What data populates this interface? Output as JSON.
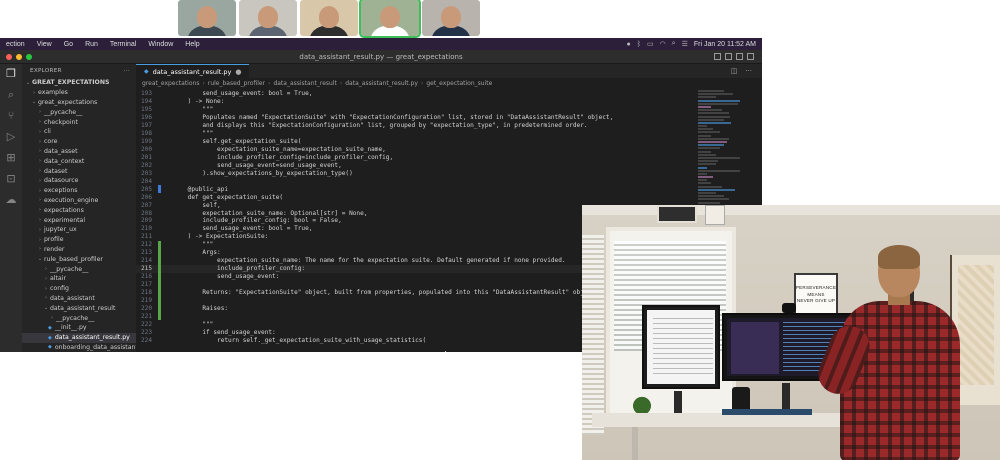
{
  "call": {
    "tiles": [
      {
        "bg": "#9aa7a1",
        "shirt": "#3d4a52"
      },
      {
        "bg": "#c9c6c0",
        "shirt": "#5b6470"
      },
      {
        "bg": "#d8c7a8",
        "shirt": "#2e2e2e"
      },
      {
        "bg": "#9fb394",
        "shirt": "#ffffff",
        "active": true
      },
      {
        "bg": "#b8b3ad",
        "shirt": "#243248"
      }
    ]
  },
  "menubar": {
    "items": [
      "ection",
      "View",
      "Go",
      "Run",
      "Terminal",
      "Window",
      "Help"
    ],
    "clock": "Fri Jan 20  11:52 AM"
  },
  "window": {
    "title": "data_assistant_result.py — great_expectations"
  },
  "explorer": {
    "heading": "EXPLORER",
    "root": "GREAT_EXPECTATIONS",
    "items": [
      {
        "label": "examples",
        "indent": 1,
        "chev": "›"
      },
      {
        "label": "great_expectations",
        "indent": 1,
        "chev": "⌄"
      },
      {
        "label": "__pycache__",
        "indent": 2,
        "chev": "›"
      },
      {
        "label": "checkpoint",
        "indent": 2,
        "chev": "›"
      },
      {
        "label": "cli",
        "indent": 2,
        "chev": "›"
      },
      {
        "label": "core",
        "indent": 2,
        "chev": "›"
      },
      {
        "label": "data_asset",
        "indent": 2,
        "chev": "›"
      },
      {
        "label": "data_context",
        "indent": 2,
        "chev": "›"
      },
      {
        "label": "dataset",
        "indent": 2,
        "chev": "›"
      },
      {
        "label": "datasource",
        "indent": 2,
        "chev": "›"
      },
      {
        "label": "exceptions",
        "indent": 2,
        "chev": "›"
      },
      {
        "label": "execution_engine",
        "indent": 2,
        "chev": "›"
      },
      {
        "label": "expectations",
        "indent": 2,
        "chev": "›"
      },
      {
        "label": "experimental",
        "indent": 2,
        "chev": "›"
      },
      {
        "label": "jupyter_ux",
        "indent": 2,
        "chev": "›"
      },
      {
        "label": "profile",
        "indent": 2,
        "chev": "›"
      },
      {
        "label": "render",
        "indent": 2,
        "chev": "›"
      },
      {
        "label": "rule_based_profiler",
        "indent": 2,
        "chev": "⌄"
      },
      {
        "label": "__pycache__",
        "indent": 3,
        "chev": "›"
      },
      {
        "label": "altair",
        "indent": 3,
        "chev": "›"
      },
      {
        "label": "config",
        "indent": 3,
        "chev": "›"
      },
      {
        "label": "data_assistant",
        "indent": 3,
        "chev": "›"
      },
      {
        "label": "data_assistant_result",
        "indent": 3,
        "chev": "⌄"
      },
      {
        "label": "__pycache__",
        "indent": 4,
        "chev": "›"
      },
      {
        "label": "__init__.py",
        "indent": 4,
        "py": true
      },
      {
        "label": "data_assistant_result.py",
        "indent": 4,
        "py": true,
        "selected": true
      },
      {
        "label": "onboarding_data_assistant_re...",
        "indent": 4,
        "py": true
      }
    ]
  },
  "editor": {
    "tab_label": "data_assistant_result.py",
    "breadcrumb": [
      "great_expectations",
      "rule_based_profiler",
      "data_assistant_result",
      "data_assistant_result.py",
      "get_expectation_suite"
    ],
    "current_line": 215,
    "lines": [
      {
        "n": 193,
        "t": "        send_usage_event: bool = True,",
        "g": ""
      },
      {
        "n": 194,
        "t": "    ) -> None:",
        "g": ""
      },
      {
        "n": 195,
        "t": "        \"\"\"",
        "g": ""
      },
      {
        "n": 196,
        "t": "        Populates named \"ExpectationSuite\" with \"ExpectationConfiguration\" list, stored in \"DataAssistantResult\" object,",
        "g": ""
      },
      {
        "n": 197,
        "t": "        and displays this \"ExpectationConfiguration\" list, grouped by \"expectation_type\", in predetermined order.",
        "g": ""
      },
      {
        "n": 198,
        "t": "        \"\"\"",
        "g": ""
      },
      {
        "n": 199,
        "t": "        self.get_expectation_suite(",
        "g": ""
      },
      {
        "n": 200,
        "t": "            expectation_suite_name=expectation_suite_name,",
        "g": ""
      },
      {
        "n": 201,
        "t": "            include_profiler_config=include_profiler_config,",
        "g": ""
      },
      {
        "n": 202,
        "t": "            send_usage_event=send_usage_event,",
        "g": ""
      },
      {
        "n": 203,
        "t": "        ).show_expectations_by_expectation_type()",
        "g": ""
      },
      {
        "n": 204,
        "t": "",
        "g": ""
      },
      {
        "n": 205,
        "t": "    @public_api",
        "g": "mod"
      },
      {
        "n": 206,
        "t": "    def get_expectation_suite(",
        "g": ""
      },
      {
        "n": 207,
        "t": "        self,",
        "g": ""
      },
      {
        "n": 208,
        "t": "        expectation_suite_name: Optional[str] = None,",
        "g": ""
      },
      {
        "n": 209,
        "t": "        include_profiler_config: bool = False,",
        "g": ""
      },
      {
        "n": 210,
        "t": "        send_usage_event: bool = True,",
        "g": ""
      },
      {
        "n": 211,
        "t": "    ) -> ExpectationSuite:",
        "g": ""
      },
      {
        "n": 212,
        "t": "        \"\"\"",
        "g": "add"
      },
      {
        "n": 213,
        "t": "        Args:",
        "g": "add"
      },
      {
        "n": 214,
        "t": "            expectation_suite_name: The name for the expectation suite. Default generated if none provided.",
        "g": "add"
      },
      {
        "n": 215,
        "t": "            include_profiler_config:",
        "g": "add"
      },
      {
        "n": 216,
        "t": "            send_usage_event:",
        "g": "add"
      },
      {
        "n": 217,
        "t": "",
        "g": "add"
      },
      {
        "n": 218,
        "t": "        Returns: \"ExpectationSuite\" object, built from properties, populated into this \"DataAssistantResult\" object.",
        "g": "add"
      },
      {
        "n": 219,
        "t": "",
        "g": "add"
      },
      {
        "n": 220,
        "t": "        Raises:",
        "g": "add"
      },
      {
        "n": 221,
        "t": "",
        "g": "add"
      },
      {
        "n": 222,
        "t": "        \"\"\"",
        "g": ""
      },
      {
        "n": 223,
        "t": "        if send_usage_event:",
        "g": ""
      },
      {
        "n": 224,
        "t": "            return self._get_expectation_suite_with_usage_statistics(",
        "g": ""
      }
    ]
  },
  "photo": {
    "sign_lines": [
      "PERSEVERANCE",
      "MEANS",
      "NEVER GIVE UP"
    ]
  },
  "colors": {
    "accent": "#4b9be0",
    "modified": "#3f7ad6",
    "added": "#57a64a",
    "active_speaker": "#3fbf5a"
  }
}
